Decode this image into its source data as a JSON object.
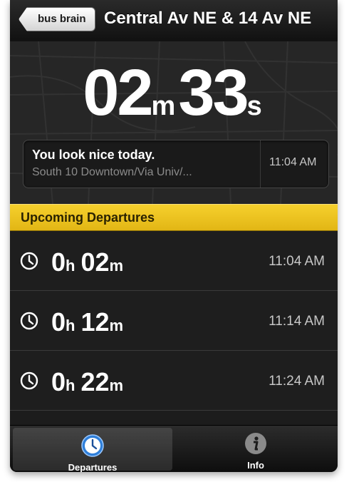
{
  "nav": {
    "back_label": "bus brain",
    "title": "Central Av NE & 14 Av NE"
  },
  "countdown": {
    "minutes": "02",
    "minutes_unit": "m",
    "seconds": "33",
    "seconds_unit": "s"
  },
  "next_departure": {
    "message": "You look nice today.",
    "route": "South 10 Downtown/Via Univ/...",
    "time": "11:04 AM"
  },
  "section_header": "Upcoming Departures",
  "departures": [
    {
      "hours": "0",
      "hours_unit": "h",
      "minutes": "02",
      "minutes_unit": "m",
      "time": "11:04 AM"
    },
    {
      "hours": "0",
      "hours_unit": "h",
      "minutes": "12",
      "minutes_unit": "m",
      "time": "11:14 AM"
    },
    {
      "hours": "0",
      "hours_unit": "h",
      "minutes": "22",
      "minutes_unit": "m",
      "time": "11:24 AM"
    }
  ],
  "tabs": [
    {
      "label": "Departures",
      "icon": "clock-icon",
      "active": true
    },
    {
      "label": "Info",
      "icon": "info-icon",
      "active": false
    }
  ],
  "colors": {
    "accent": "#e8c01d",
    "background": "#1e1e1e",
    "tab_active_icon": "#2f7fd9"
  }
}
